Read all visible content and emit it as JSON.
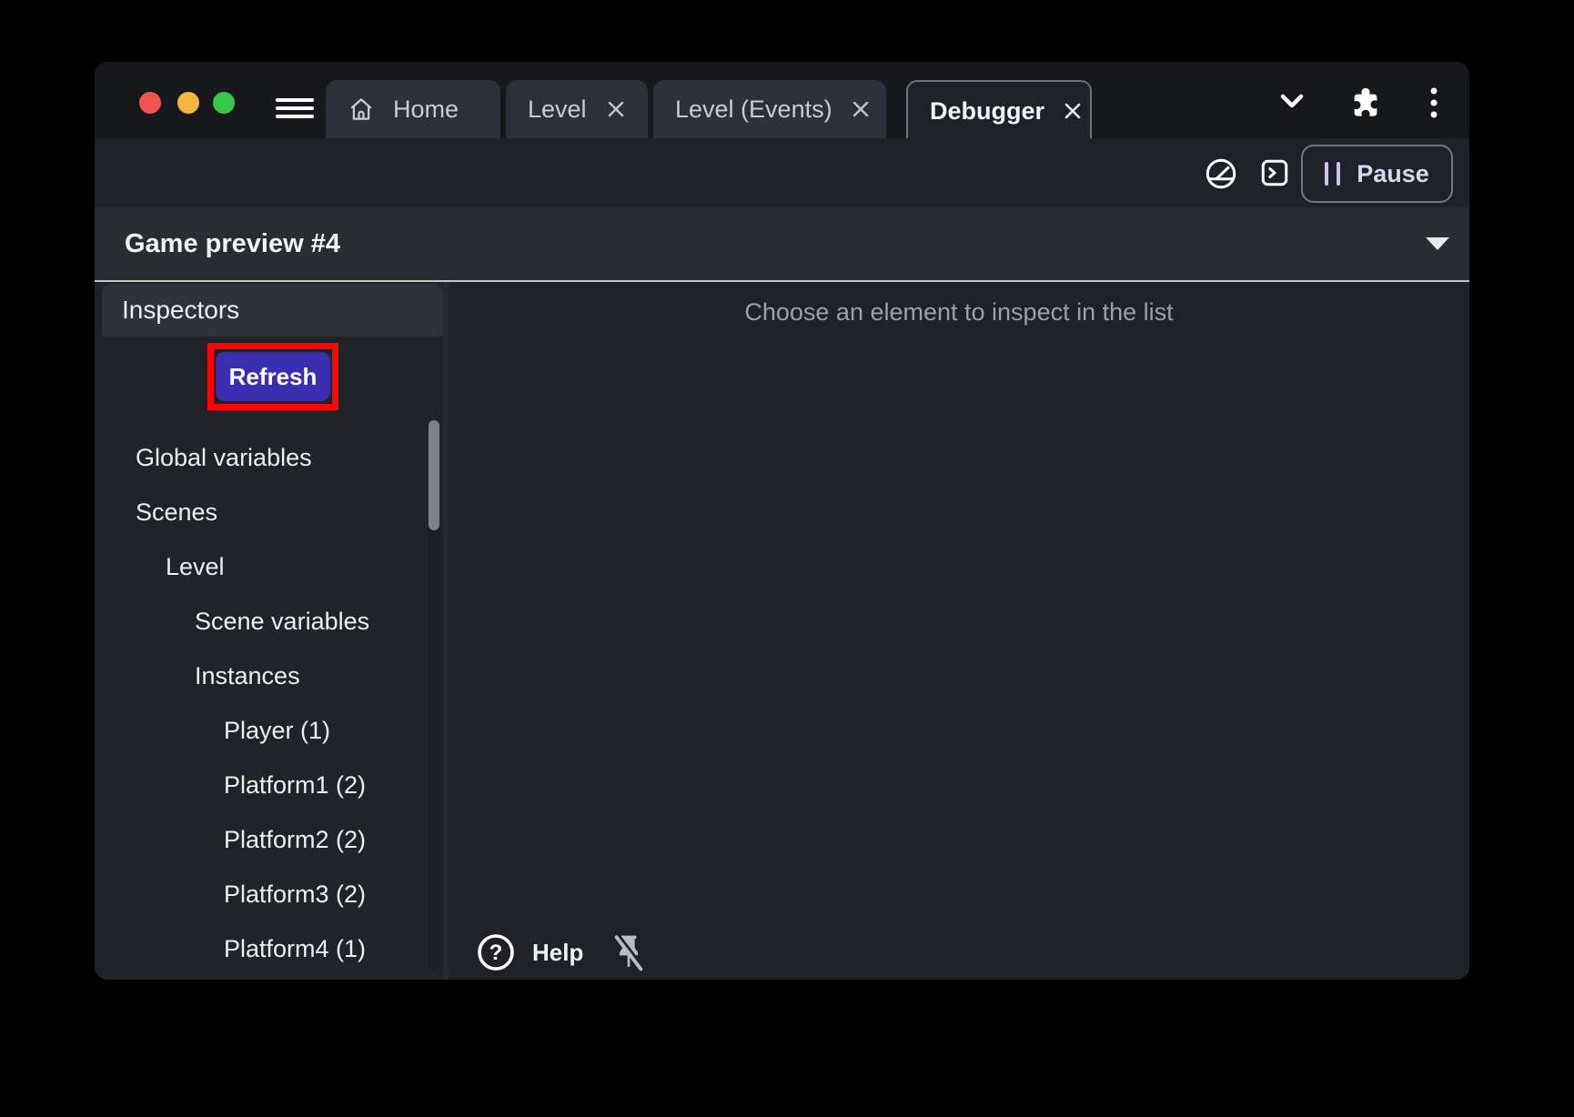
{
  "tabs": [
    {
      "label": "Home"
    },
    {
      "label": "Level"
    },
    {
      "label": "Level (Events)"
    },
    {
      "label": "Debugger"
    }
  ],
  "toolbar": {
    "pause_label": "Pause"
  },
  "preview_selector": {
    "label": "Game preview #4"
  },
  "sidebar": {
    "header": "Inspectors",
    "refresh_label": "Refresh",
    "items": [
      {
        "label": "Global variables"
      },
      {
        "label": "Scenes"
      },
      {
        "label": "Level"
      },
      {
        "label": "Scene variables"
      },
      {
        "label": "Instances"
      },
      {
        "label": "Player (1)"
      },
      {
        "label": "Platform1 (2)"
      },
      {
        "label": "Platform2 (2)"
      },
      {
        "label": "Platform3 (2)"
      },
      {
        "label": "Platform4 (1)"
      }
    ]
  },
  "main": {
    "empty_message": "Choose an element to inspect in the list",
    "help_label": "Help"
  },
  "icons": {
    "help_glyph": "?",
    "home": "home-icon",
    "close": "close-icon",
    "menu": "hamburger-menu-icon",
    "chevron_down": "chevron-down-icon",
    "puzzle": "extensions-puzzle-icon",
    "kebab": "kebab-menu-icon",
    "gauge": "profiler-gauge-icon",
    "console": "console-icon",
    "pause": "pause-icon",
    "caret_down": "caret-down-icon",
    "pin_off": "pin-off-icon"
  },
  "colors": {
    "highlight_red": "#fb0606",
    "accent_purple": "#3b2db0",
    "pause_text": "#dcd5f2",
    "traffic_red": "#f5534f",
    "traffic_yellow": "#f5b63d",
    "traffic_green": "#36c84b"
  }
}
